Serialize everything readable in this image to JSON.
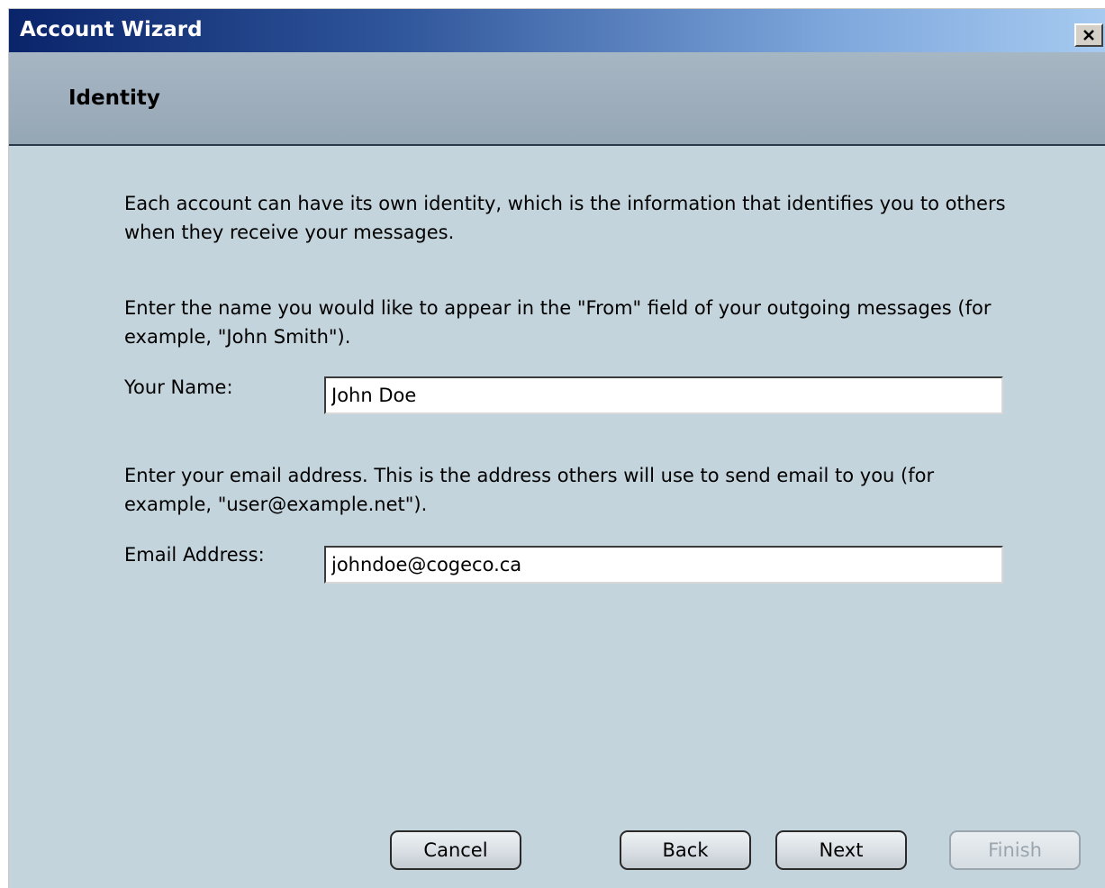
{
  "window": {
    "title": "Account Wizard",
    "close_label": "X"
  },
  "page": {
    "title": "Identity"
  },
  "intro_text": "Each account can have its own identity, which is the information that identifies you to others when they receive your messages.",
  "name_section": {
    "instructions": "Enter the name you would like to appear in the \"From\" field of your outgoing messages (for example, \"John Smith\").",
    "label": "Your Name:",
    "value": "John Doe"
  },
  "email_section": {
    "instructions": "Enter your email address. This is the address others will use to send email to you (for example, \"user@example.net\").",
    "label": "Email Address:",
    "value": "johndoe@cogeco.ca"
  },
  "buttons": {
    "cancel": "Cancel",
    "back": "Back",
    "next": "Next",
    "finish": "Finish"
  }
}
